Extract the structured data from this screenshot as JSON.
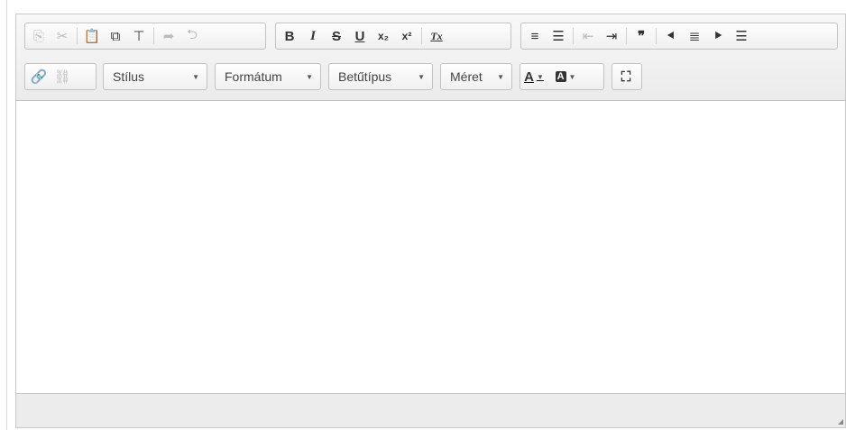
{
  "toolbar": {
    "row1": {
      "clipboard_group": [
        "copy-icon",
        "cut-icon",
        "paste-icon",
        "paste-word-icon",
        "paste-text-icon",
        "redo-icon",
        "undo-icon"
      ],
      "format_group": {
        "bold": "B",
        "italic": "I",
        "strike": "S",
        "underline": "U",
        "subscript": "x₂",
        "superscript": "x²",
        "remove_format": "Tx"
      },
      "paragraph_group": [
        "numbered-list-icon",
        "bulleted-list-icon",
        "decrease-indent-icon",
        "increase-indent-icon",
        "blockquote-icon",
        "align-left-icon",
        "align-center-icon",
        "align-right-icon",
        "justify-icon"
      ]
    },
    "row2": {
      "style_label": "Stílus",
      "format_label": "Formátum",
      "font_label": "Betűtípus",
      "size_label": "Méret",
      "text_color_glyph": "A",
      "bg_color_glyph": "A"
    }
  },
  "colors": {
    "toolbar_bg": "#efefef",
    "border": "#c2c2c2",
    "disabled_icon": "#bcbcbc",
    "icon": "#333333"
  }
}
